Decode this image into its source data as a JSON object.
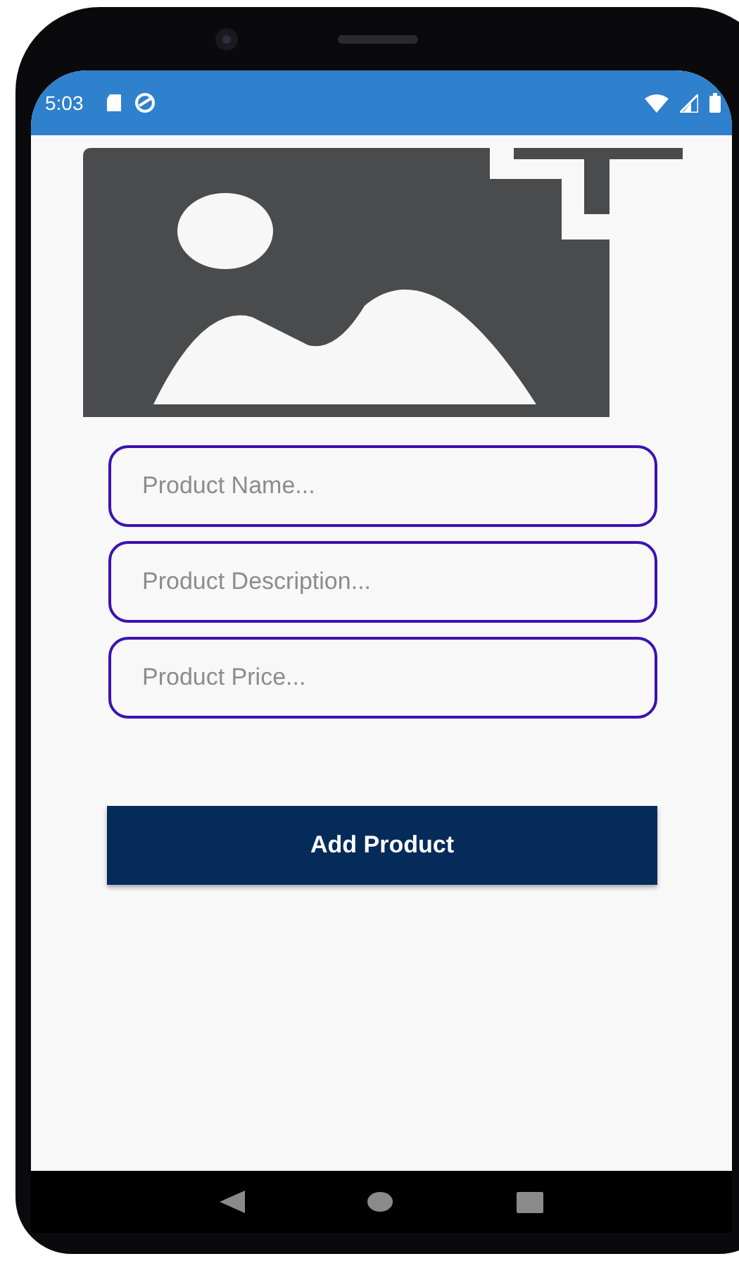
{
  "status_bar": {
    "time": "5:03"
  },
  "form": {
    "fields": [
      {
        "placeholder": "Product Name..."
      },
      {
        "placeholder": "Product Description..."
      },
      {
        "placeholder": "Product Price..."
      }
    ],
    "submit_button": {
      "label": "Add Product"
    }
  }
}
